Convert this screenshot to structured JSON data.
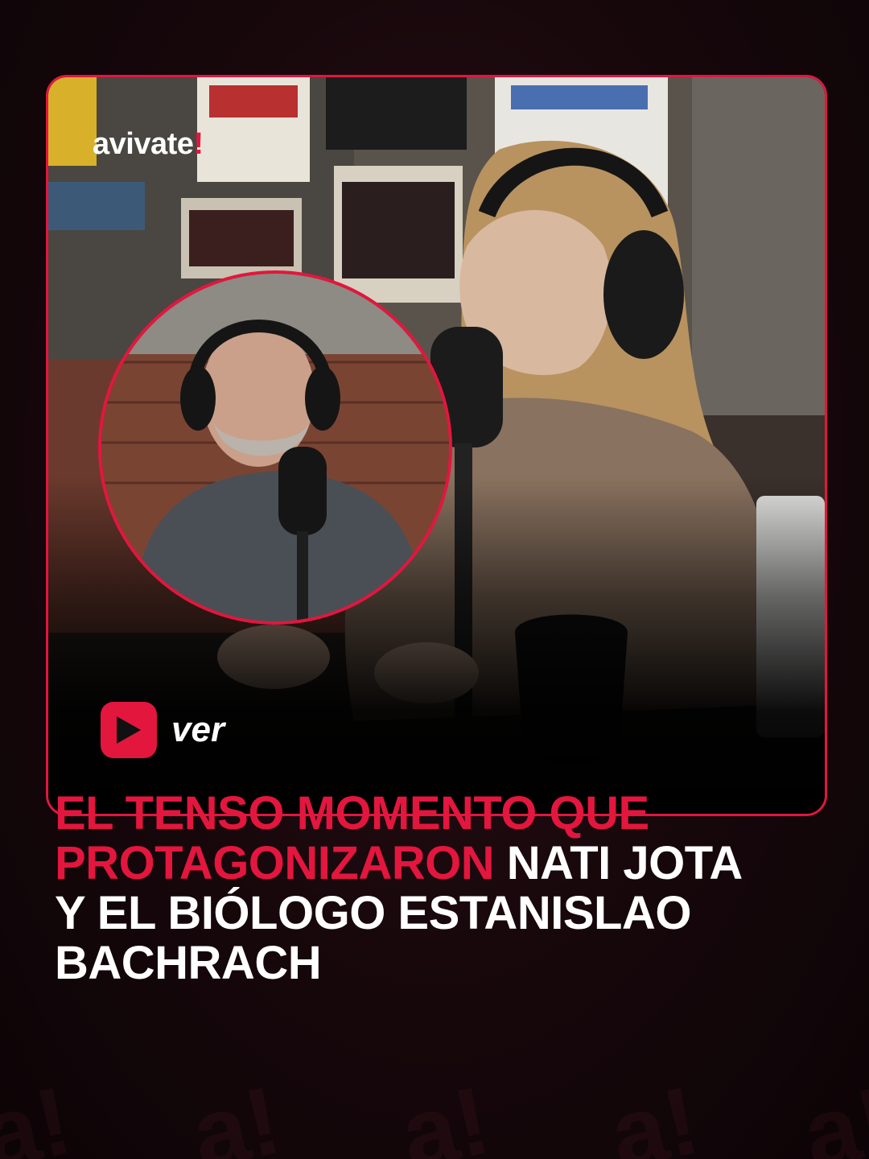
{
  "brand": {
    "name": "avivate",
    "mark": "!"
  },
  "watch": {
    "label": "ver",
    "icon": "play-icon"
  },
  "headline": {
    "highlight": "EL TENSO MOMENTO QUE PROTAGONIZARON",
    "rest": "NATI JOTA Y EL BIÓLOGO ESTANISLAO BACHRACH"
  },
  "colors": {
    "accent": "#e3163e",
    "background": "#16070b",
    "text": "#ffffff"
  }
}
